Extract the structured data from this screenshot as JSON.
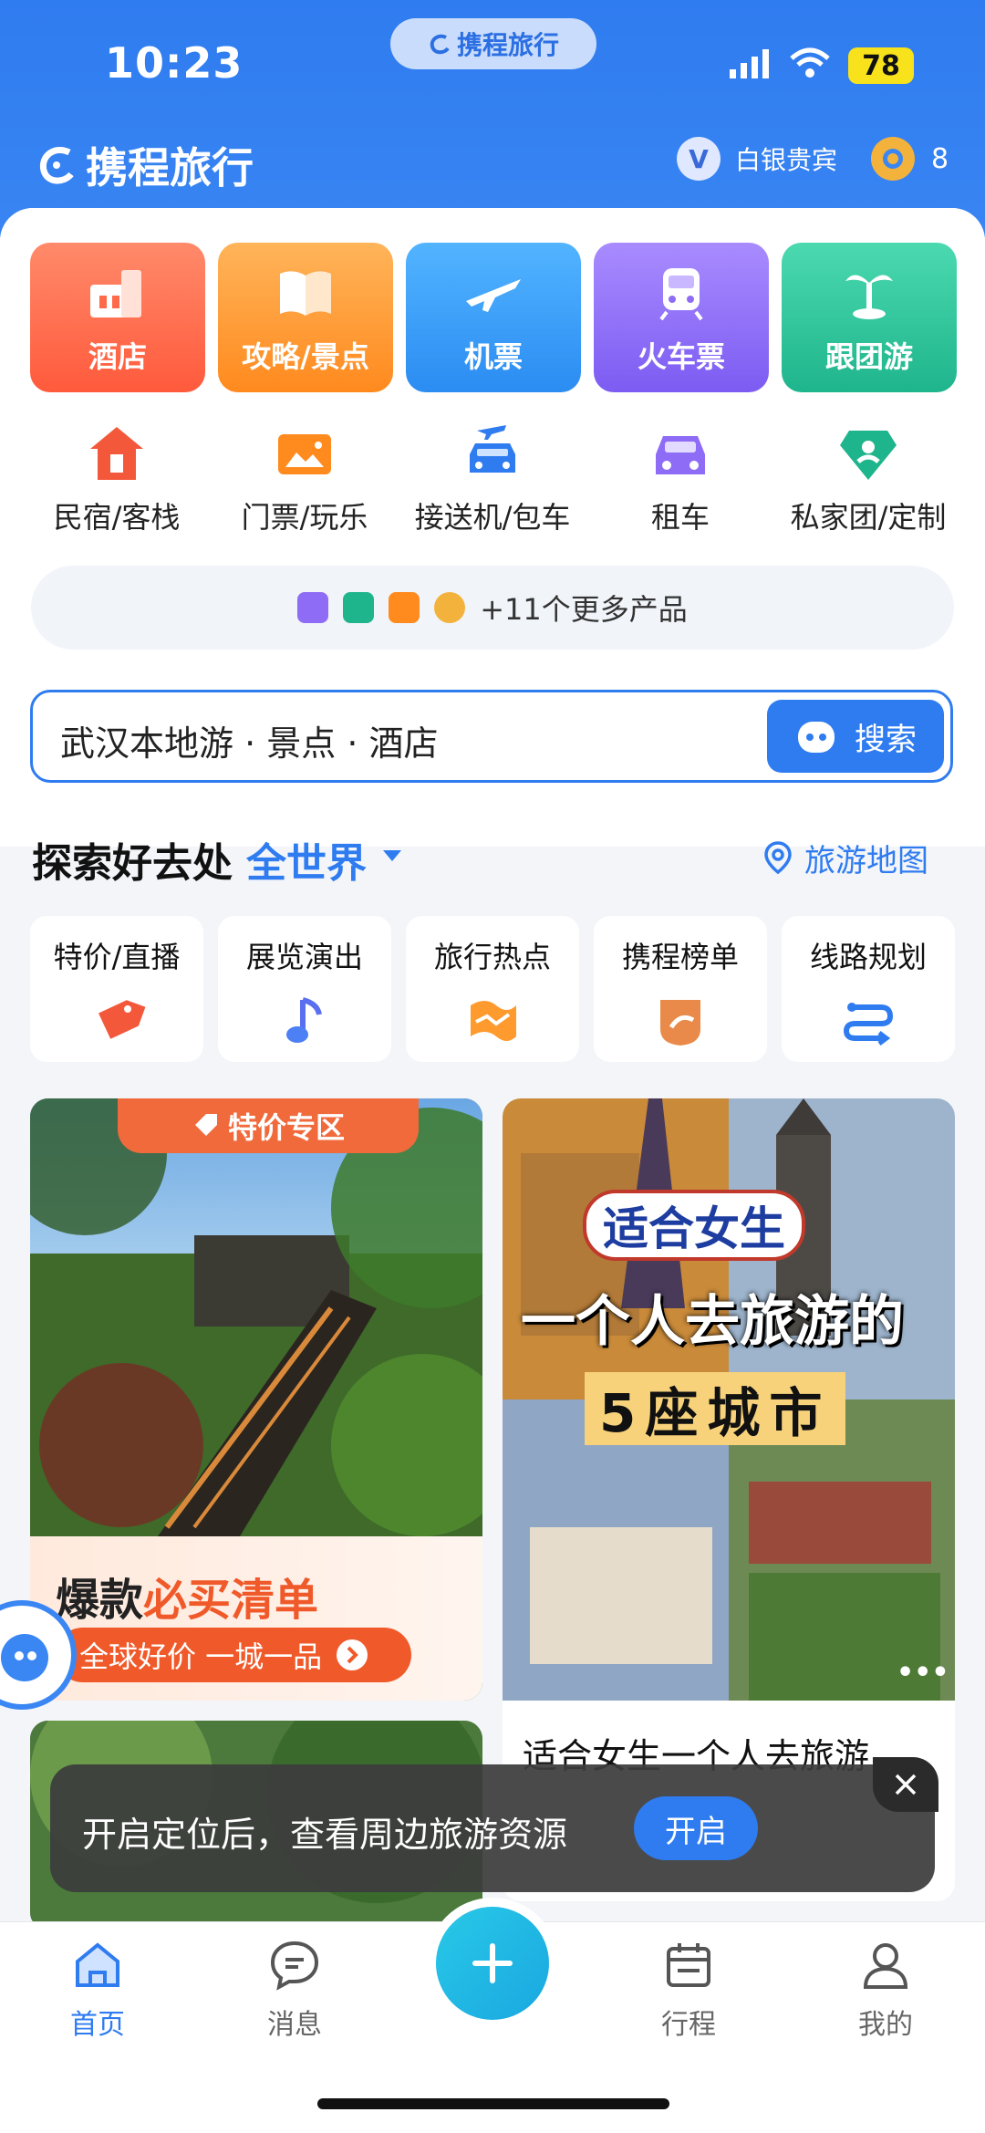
{
  "status_bar": {
    "time": "10:23",
    "app_pill": "携程旅行",
    "battery": "78"
  },
  "header": {
    "logo_text": "携程旅行",
    "member_badge": "V",
    "member_level": "白银贵宾",
    "coins": "8"
  },
  "big_tiles": [
    {
      "label": "酒店",
      "color": "#ff6a4a"
    },
    {
      "label": "攻略/景点",
      "color": "#ff9a2e"
    },
    {
      "label": "机票",
      "color": "#2f9af5"
    },
    {
      "label": "火车票",
      "color": "#8e6cf5"
    },
    {
      "label": "跟团游",
      "color": "#26c39a"
    }
  ],
  "small_tiles": [
    {
      "label": "民宿/客栈",
      "icon": "house-icon"
    },
    {
      "label": "门票/玩乐",
      "icon": "ticket-icon"
    },
    {
      "label": "接送机/包车",
      "icon": "car-plane-icon"
    },
    {
      "label": "租车",
      "icon": "car-icon"
    },
    {
      "label": "私家团/定制",
      "icon": "diamond-icon"
    }
  ],
  "more_products": "+11个更多产品",
  "search": {
    "placeholder": "武汉本地游 · 景点 · 酒店",
    "button": "搜索"
  },
  "explore": {
    "title": "探索好去处",
    "region": "全世界",
    "map_link": "旅游地图"
  },
  "categories": [
    {
      "label": "特价/直播"
    },
    {
      "label": "展览演出"
    },
    {
      "label": "旅行热点"
    },
    {
      "label": "携程榜单"
    },
    {
      "label": "线路规划"
    }
  ],
  "card_left": {
    "tag": "特价专区",
    "title_part1": "爆款",
    "title_part2": "必买清单",
    "subtitle": "全球好价 一城一品"
  },
  "card_right": {
    "overlay1": "适合女生",
    "overlay2": "一个人去旅游的",
    "overlay3": "5座城市",
    "title": "适合女生一个人去旅游"
  },
  "toast": {
    "text": "开启定位后，查看周边旅游资源",
    "button": "开启"
  },
  "tabs": [
    {
      "label": "首页",
      "active": true
    },
    {
      "label": "消息"
    },
    {
      "label": "行程"
    },
    {
      "label": "我的"
    }
  ],
  "colors": {
    "brand": "#2f7cf0",
    "accent_orange": "#f05a2a"
  }
}
